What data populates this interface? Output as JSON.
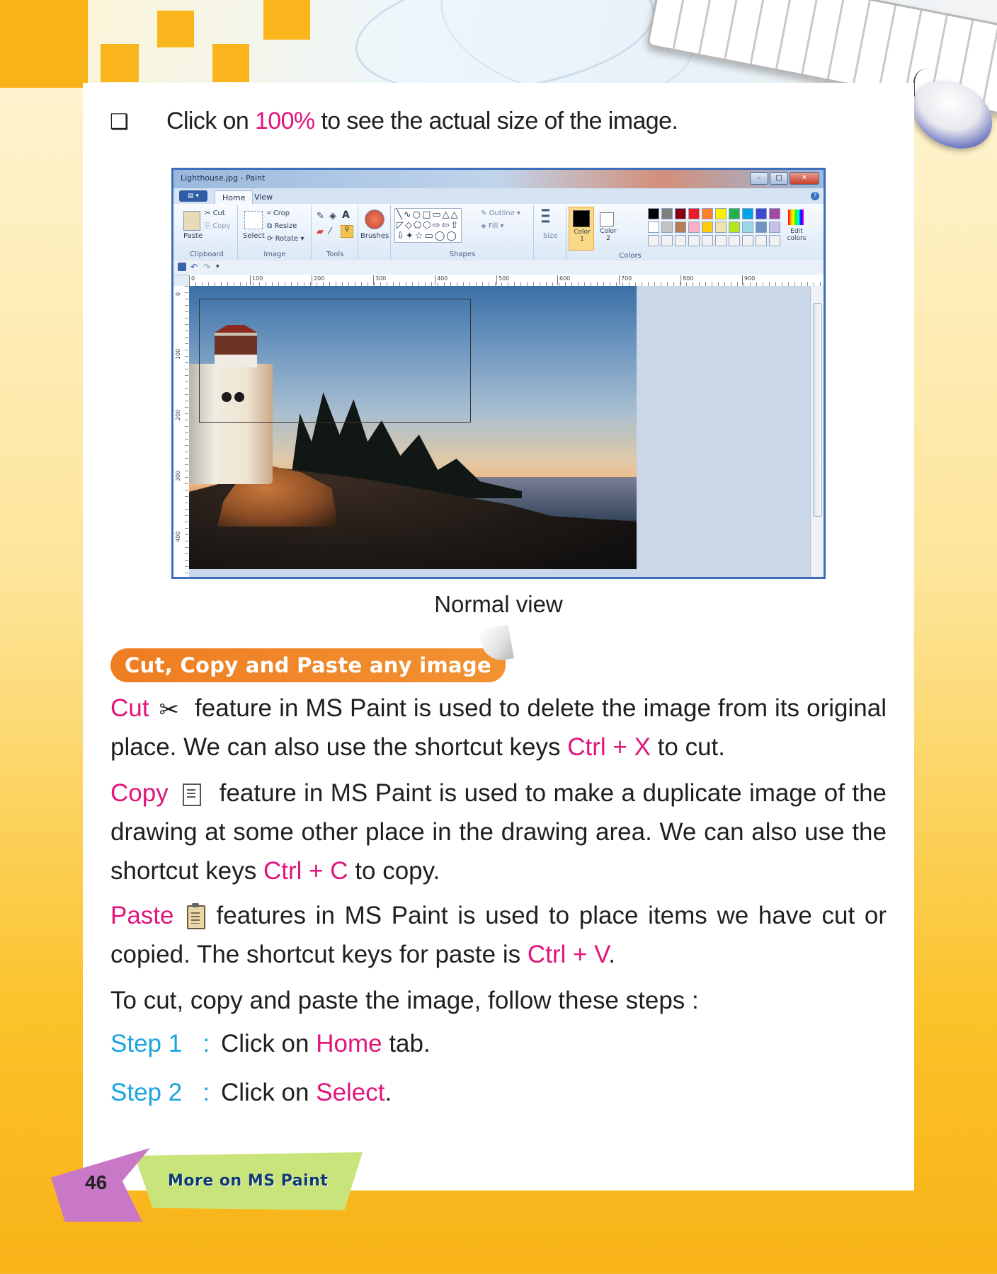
{
  "bullet": {
    "symbol": "❑",
    "pre": "Click on",
    "highlight": "100%",
    "post": "to see the actual size of the image."
  },
  "paint_window": {
    "title": "Lighthouse.jpg - Paint",
    "tabs": [
      "Home",
      "View"
    ],
    "clipboard": {
      "paste": "Paste",
      "cut": "Cut",
      "copy": "Copy",
      "group": "Clipboard"
    },
    "image": {
      "select": "Select",
      "crop": "Crop",
      "resize": "Resize",
      "rotate": "Rotate",
      "group": "Image"
    },
    "tools_group": "Tools",
    "brushes": "Brushes",
    "shapes": {
      "outline": "Outline",
      "fill": "Fill",
      "group": "Shapes"
    },
    "size": "Size",
    "color1": "Color 1",
    "color2": "Color 2",
    "edit_colors": "Edit colors",
    "colors_group": "Colors",
    "ruler_ticks": [
      "0",
      "100",
      "200",
      "300",
      "400",
      "500",
      "600",
      "700",
      "800",
      "900"
    ],
    "vruler_ticks": [
      "0",
      "100",
      "200",
      "300",
      "400"
    ],
    "palette": [
      "#000000",
      "#7f7f7f",
      "#880015",
      "#ed1c24",
      "#ff7f27",
      "#fff200",
      "#22b14c",
      "#00a2e8",
      "#3f48cc",
      "#a349a4",
      "#ffffff",
      "#c3c3c3",
      "#b97a57",
      "#ffaec9",
      "#ffc90e",
      "#efe4b0",
      "#b5e61d",
      "#99d9ea",
      "#7092be",
      "#c8bfe7",
      "#f2f2f2",
      "#f2f2f2",
      "#f2f2f2",
      "#f2f2f2",
      "#f2f2f2",
      "#f2f2f2",
      "#f2f2f2",
      "#f2f2f2",
      "#f2f2f2",
      "#f2f2f2"
    ]
  },
  "caption": "Normal view",
  "section_title": "Cut, Copy and Paste any image",
  "cut": {
    "term": "Cut",
    "text": "feature in MS Paint is used to delete the image from its original place. We can also use the shortcut keys",
    "keys": "Ctrl + X",
    "end": "to cut."
  },
  "copy": {
    "term": "Copy",
    "text": "feature in MS Paint is used to make a duplicate image of the drawing at some other place in the drawing area. We can also use the shortcut keys",
    "keys": "Ctrl + C",
    "end": "to copy."
  },
  "paste": {
    "term": "Paste",
    "text": "features in MS Paint is used to place items we have cut or copied. The shortcut keys for paste is",
    "keys": "Ctrl + V",
    "end": "."
  },
  "intro": "To cut, copy and paste the image, follow these steps :",
  "steps": [
    {
      "label": "Step 1",
      "colon": ":",
      "pre": "Click on",
      "highlight": "Home",
      "post": "tab."
    },
    {
      "label": "Step 2",
      "colon": ":",
      "pre": "Click on",
      "highlight": "Select",
      "post": "."
    }
  ],
  "footer": {
    "page": "46",
    "chapter": "More on MS Paint"
  },
  "colors": {
    "accent_pink": "#e0157c",
    "accent_blue": "#1ba4df",
    "header_orange": "#ef7d22"
  }
}
